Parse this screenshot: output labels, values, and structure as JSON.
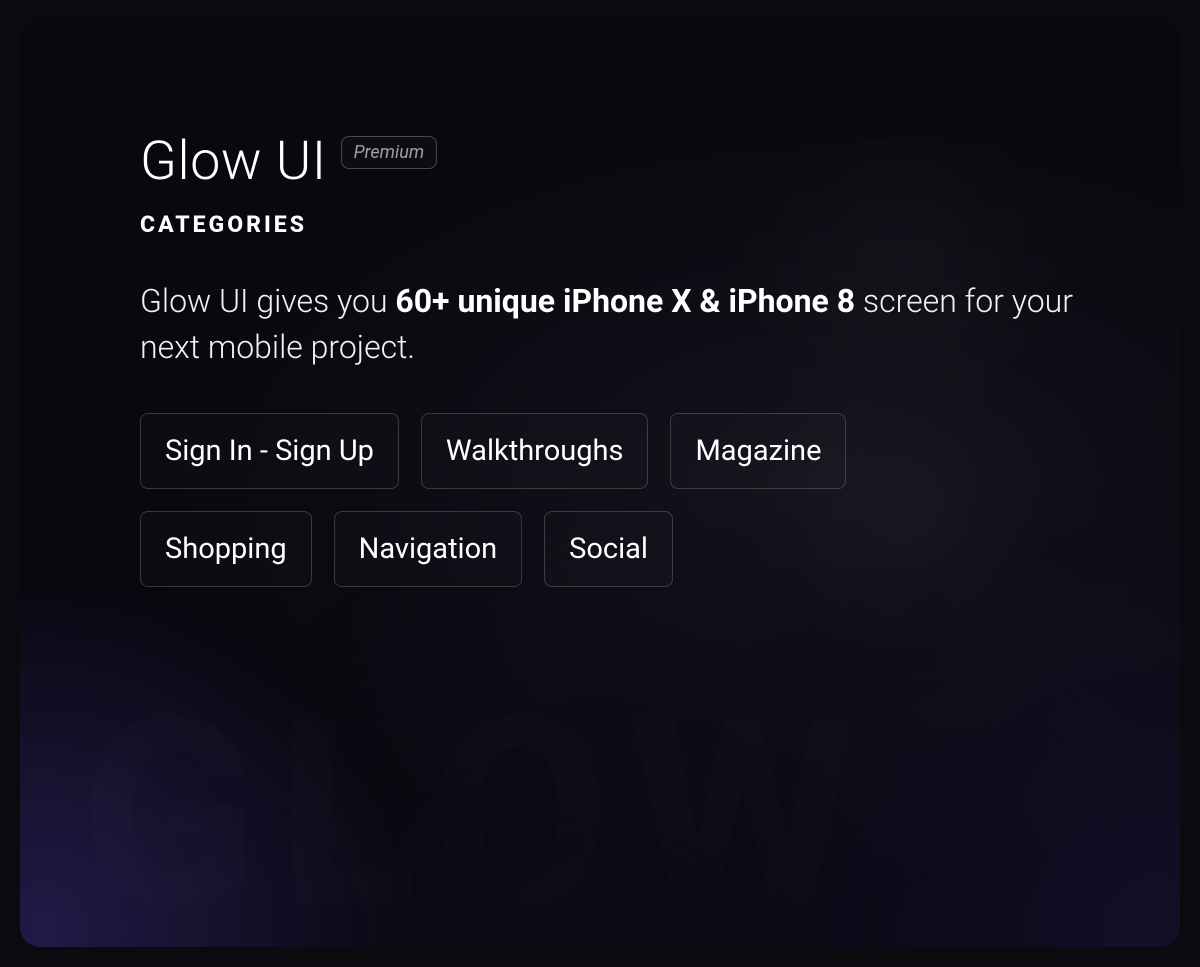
{
  "header": {
    "title": "Glow UI",
    "badge": "Premium",
    "section": "CATEGORIES"
  },
  "description": {
    "prefix": "Glow UI gives you ",
    "bold": "60+ unique iPhone X & iPhone 8",
    "suffix": " screen for your next mobile project."
  },
  "categories": [
    "Sign In - Sign Up",
    "Walkthroughs",
    "Magazine",
    "Shopping",
    "Navigation",
    "Social"
  ],
  "watermark": "GLOW"
}
